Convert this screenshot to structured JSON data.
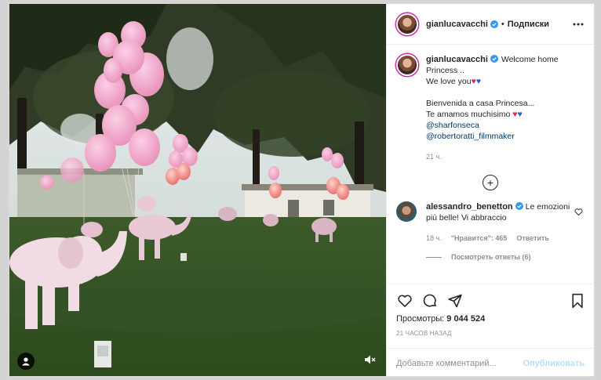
{
  "post": {
    "username": "gianlucavacchi",
    "follow_separator": "•",
    "follow_label": "Подписки",
    "caption": {
      "username": "gianlucavacchi",
      "line1": "Welcome home",
      "line2": "Princess ..",
      "line3": "We love you",
      "line4": "Bienvenida a casa Princesa...",
      "line5": "Te amamos muchisimo",
      "mention1": "@sharfonseca",
      "mention2": "@robertoratti_filmmaker",
      "time": "21 ч."
    },
    "comments": [
      {
        "username": "alessandro_benetton",
        "text": "Le emozioni più belle! Vi abbraccio",
        "time": "18 ч.",
        "likes": "\"Нравится\": 465",
        "reply_label": "Ответить",
        "view_replies": "Посмотреть ответы (6)"
      }
    ],
    "views_label": "Просмотры:",
    "views_count": "9 044 524",
    "timestamp": "21 часов назад",
    "comment_placeholder": "Добавьте комментарий...",
    "publish_label": "Опубликовать"
  },
  "icons": {
    "more": "more-options-icon",
    "like": "heart-icon",
    "comment": "comment-icon",
    "share": "share-icon",
    "save": "bookmark-icon",
    "user_tag": "user-tag-icon",
    "mute": "mute-icon",
    "verified": "verified-badge-icon",
    "load_more": "plus-circle-icon"
  },
  "colors": {
    "link": "#00376b",
    "verified": "#3897f0",
    "publish_disabled": "#b2dffc",
    "secondary_text": "#8e8e8e"
  }
}
